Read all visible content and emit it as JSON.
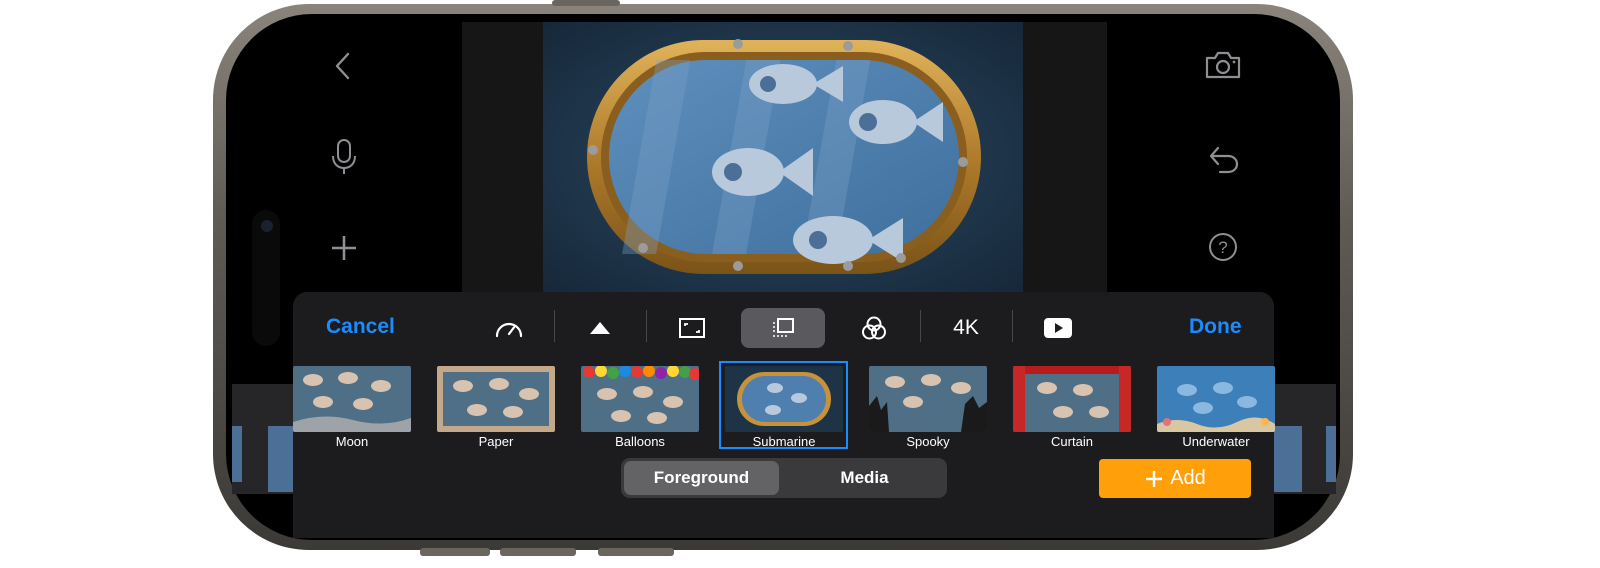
{
  "toolbar": {
    "cancel_label": "Cancel",
    "done_label": "Done",
    "resolution_label": "4K",
    "tools": [
      {
        "icon": "speed-gauge-icon"
      },
      {
        "icon": "title-triangle-icon"
      },
      {
        "icon": "crop-frame-icon"
      },
      {
        "icon": "background-layout-icon",
        "selected": true
      },
      {
        "icon": "filters-icon"
      },
      {
        "icon": "resolution-4k"
      },
      {
        "icon": "play-video-icon"
      }
    ]
  },
  "sidebar_left": {
    "icons": [
      "back-chevron-icon",
      "microphone-icon",
      "plus-icon"
    ]
  },
  "sidebar_right": {
    "icons": [
      "camera-icon",
      "undo-icon",
      "help-icon"
    ]
  },
  "themes": [
    {
      "label": "Moon"
    },
    {
      "label": "Paper"
    },
    {
      "label": "Balloons"
    },
    {
      "label": "Submarine",
      "selected": true
    },
    {
      "label": "Spooky"
    },
    {
      "label": "Curtain"
    },
    {
      "label": "Underwater"
    }
  ],
  "segmented": {
    "foreground_label": "Foreground",
    "media_label": "Media",
    "selected": "Foreground"
  },
  "add_button": {
    "label": "Add",
    "icon": "plus-icon"
  },
  "colors": {
    "accent": "#1a8cff",
    "add_orange": "#ff9f0a",
    "panel": "#1c1c1e"
  }
}
